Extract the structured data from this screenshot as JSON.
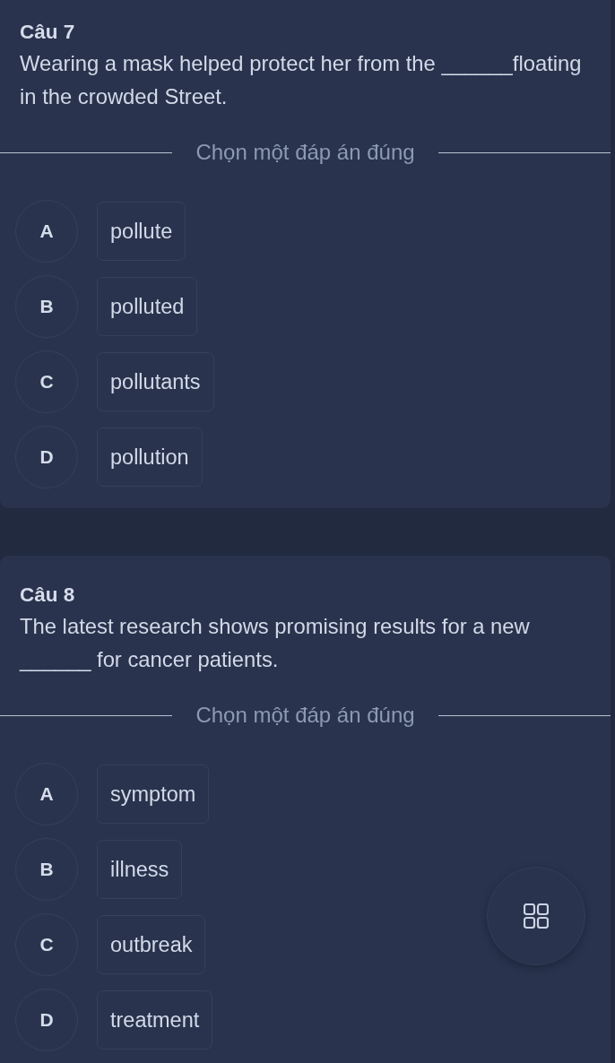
{
  "questions": [
    {
      "title": "Câu 7",
      "text": "Wearing a mask helped protect her from the ______floating in the crowded Street.",
      "prompt": "Chọn một đáp án đúng",
      "options": [
        {
          "letter": "A",
          "text": "pollute",
          "selected": false
        },
        {
          "letter": "B",
          "text": "polluted",
          "selected": false
        },
        {
          "letter": "C",
          "text": "pollutants",
          "selected": false
        },
        {
          "letter": "D",
          "text": "pollution",
          "selected": false
        }
      ]
    },
    {
      "title": "Câu 8",
      "text": "The latest research shows promising results for a new ______ for cancer patients.",
      "prompt": "Chọn một đáp án đúng",
      "options": [
        {
          "letter": "A",
          "text": "symptom",
          "selected": false
        },
        {
          "letter": "B",
          "text": "illness",
          "selected": false
        },
        {
          "letter": "C",
          "text": "outbreak",
          "selected": false
        },
        {
          "letter": "D",
          "text": "treatment",
          "selected": false
        }
      ]
    }
  ]
}
